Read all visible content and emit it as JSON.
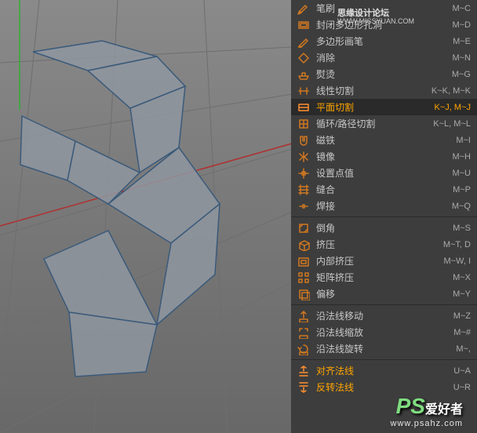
{
  "watermark": {
    "line1": "思缘设计论坛",
    "line2": "WWW.MISSYUAN.COM"
  },
  "bottom_watermark": {
    "logo": "PS",
    "han": "爱好者",
    "url": "www.psahz.com"
  },
  "menu": {
    "groups": [
      [
        {
          "icon": "brush",
          "label": "笔刷",
          "shortcut": "M~C"
        },
        {
          "icon": "close-holes",
          "label": "封闭多边形孔洞",
          "shortcut": "M~D"
        },
        {
          "icon": "poly-pen",
          "label": "多边形画笔",
          "shortcut": "M~E"
        },
        {
          "icon": "dissolve",
          "label": "消除",
          "shortcut": "M~N"
        },
        {
          "icon": "iron",
          "label": "熨烫",
          "shortcut": "M~G"
        },
        {
          "icon": "line-cut",
          "label": "线性切割",
          "shortcut": "K~K, M~K"
        },
        {
          "icon": "plane-cut",
          "label": "平面切割",
          "shortcut": "K~J, M~J",
          "selected": true
        },
        {
          "icon": "loop-cut",
          "label": "循环/路径切割",
          "shortcut": "K~L, M~L"
        },
        {
          "icon": "magnet",
          "label": "磁铁",
          "shortcut": "M~I"
        },
        {
          "icon": "mirror",
          "label": "镜像",
          "shortcut": "M~H"
        },
        {
          "icon": "set-point",
          "label": "设置点值",
          "shortcut": "M~U"
        },
        {
          "icon": "stitch",
          "label": "缝合",
          "shortcut": "M~P"
        },
        {
          "icon": "weld",
          "label": "焊接",
          "shortcut": "M~Q"
        }
      ],
      [
        {
          "icon": "bevel",
          "label": "倒角",
          "shortcut": "M~S"
        },
        {
          "icon": "extrude",
          "label": "挤压",
          "shortcut": "M~T, D"
        },
        {
          "icon": "inner-extrude",
          "label": "内部挤压",
          "shortcut": "M~W, I"
        },
        {
          "icon": "matrix-extrude",
          "label": "矩阵挤压",
          "shortcut": "M~X"
        },
        {
          "icon": "offset",
          "label": "偏移",
          "shortcut": "M~Y"
        }
      ],
      [
        {
          "icon": "normal-move",
          "label": "沿法线移动",
          "shortcut": "M~Z"
        },
        {
          "icon": "normal-scale",
          "label": "沿法线缩放",
          "shortcut": "M~#"
        },
        {
          "icon": "normal-rotate",
          "label": "沿法线旋转",
          "shortcut": "M~,"
        }
      ],
      [
        {
          "icon": "align-normal",
          "label": "对齐法线",
          "shortcut": "U~A",
          "highlight": true
        },
        {
          "icon": "reverse-normal",
          "label": "反转法线",
          "shortcut": "U~R",
          "highlight": true
        }
      ]
    ]
  },
  "colors": {
    "accent": "#ffa500",
    "menu_bg": "#3d3d3d",
    "text": "#c8c8c8"
  }
}
